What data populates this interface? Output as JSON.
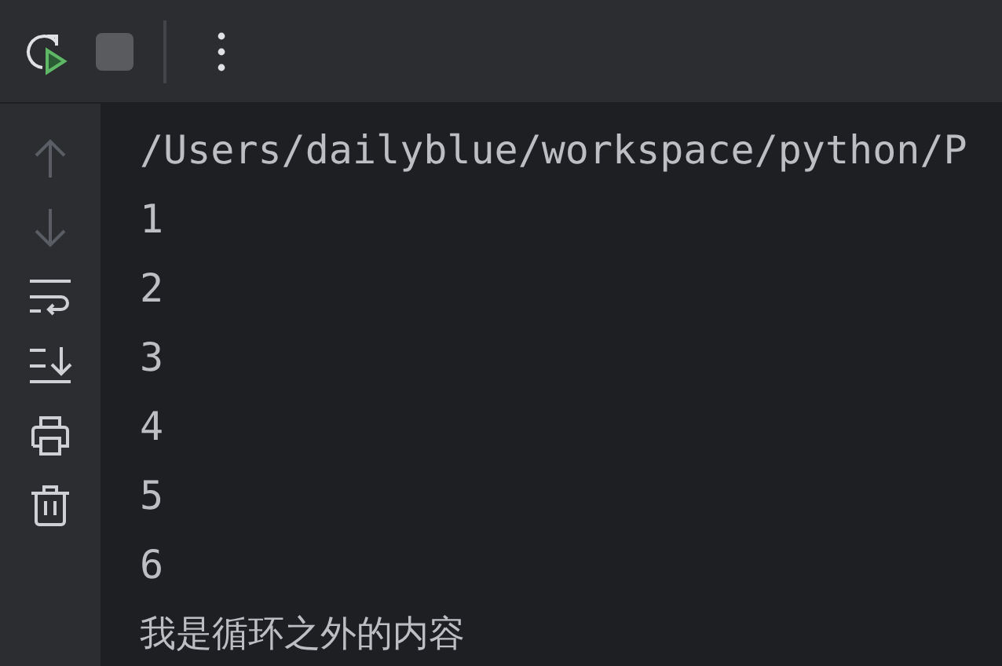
{
  "toolbar": [
    {
      "kind": "rerun",
      "disabled": false
    },
    {
      "kind": "stop",
      "disabled": true
    },
    {
      "kind": "more",
      "disabled": false
    }
  ],
  "sidebar": [
    {
      "kind": "up",
      "disabled": true
    },
    {
      "kind": "down",
      "disabled": true
    },
    {
      "kind": "wrap",
      "disabled": false
    },
    {
      "kind": "scroll-end",
      "disabled": false
    },
    {
      "kind": "print",
      "disabled": false
    },
    {
      "kind": "trash",
      "disabled": false
    }
  ],
  "console": {
    "lines": [
      "/Users/dailyblue/workspace/python/P",
      "1",
      "2",
      "3",
      "4",
      "5",
      "6",
      "我是循环之外的内容"
    ]
  }
}
